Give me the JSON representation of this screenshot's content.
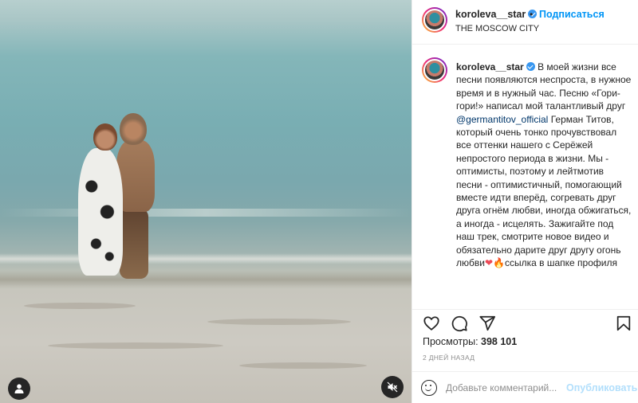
{
  "header": {
    "username": "koroleva__star",
    "separator": "•",
    "follow_label": "Подписаться",
    "location": "THE MOSCOW CITY"
  },
  "caption": {
    "username": "koroleva__star",
    "text_1": " В моей жизни все песни появляются неспроста, в нужное время и в нужный час. Песню «Гори-гори!» написал мой талантливый друг ",
    "mention": "@germantitov_official",
    "text_2": " Герман Титов, который очень тонко прочувствовал все оттенки нашего с Серёжей непростого периода в жизни. Мы - оптимисты, поэтому и лейтмотив песни - оптимистичный, помогающий вместе идти вперёд, согревать друг друга огнём любви, иногда обжигаться, а иногда - исцелять. Зажигайте под наш трек, смотрите новое видео и обязательно дарите друг другу огонь любви",
    "emoji_heart": "❤",
    "emoji_fire": "🔥",
    "text_3": "ссылка в шапке профиля"
  },
  "stats": {
    "views_label": "Просмотры:",
    "views_value": "398 101",
    "time_ago": "2 ДНЕЙ НАЗАД"
  },
  "comment": {
    "placeholder": "Добавьте комментарий...",
    "post_label": "Опубликовать"
  },
  "icons": {
    "like": "heart-outline-icon",
    "comment": "speech-bubble-icon",
    "share": "paper-plane-icon",
    "save": "bookmark-icon",
    "user_tag": "user-icon",
    "mute": "speaker-muted-icon",
    "emoji": "smiley-icon"
  },
  "colors": {
    "accent": "#0095f6",
    "verified": "#3897f0",
    "post_disabled": "#b2dffc",
    "mention": "#00376b"
  }
}
